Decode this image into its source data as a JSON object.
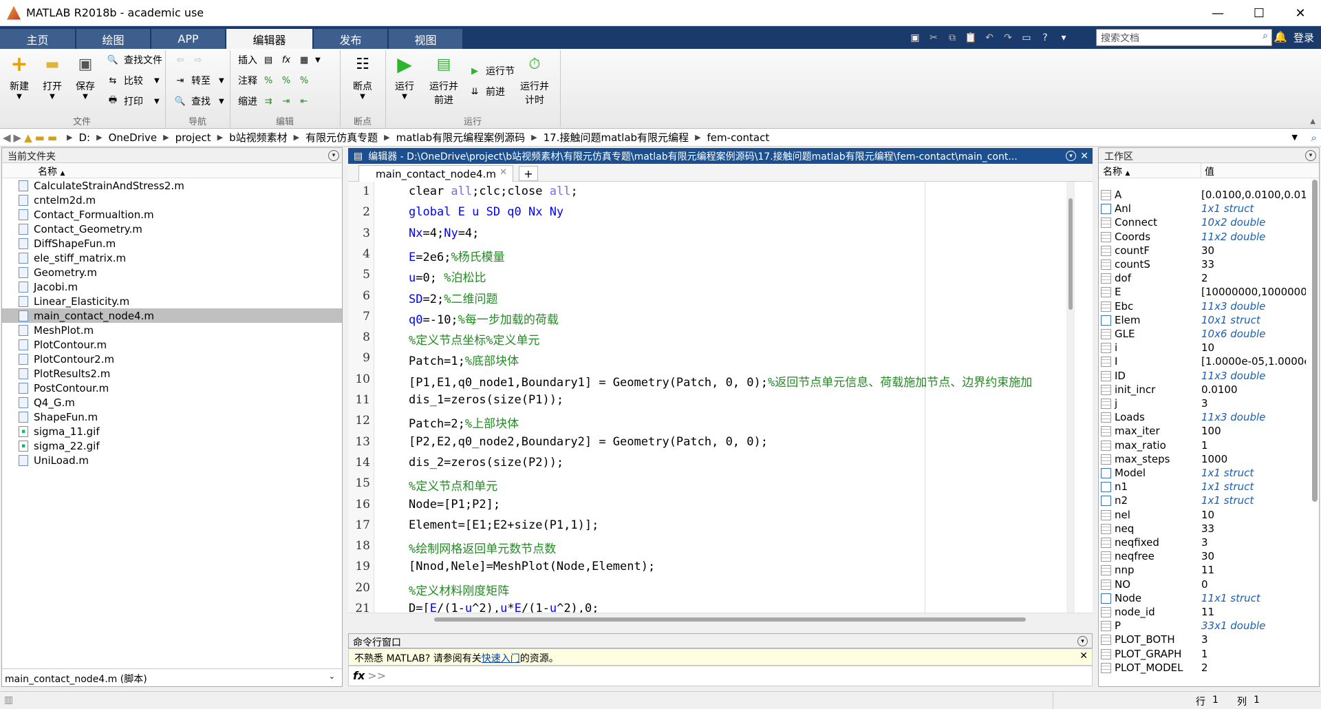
{
  "window": {
    "title": "MATLAB R2018b - academic use"
  },
  "ribbon_tabs": [
    "主页",
    "绘图",
    "APP",
    "编辑器",
    "发布",
    "视图"
  ],
  "search": {
    "placeholder": "搜索文档"
  },
  "login": "登录",
  "ribbon": {
    "file": {
      "new": "新建",
      "open": "打开",
      "save": "保存",
      "find_files": "查找文件",
      "compare": "比较",
      "print": "打印",
      "group": "文件"
    },
    "nav": {
      "goto": "转至",
      "find": "查找",
      "group": "导航"
    },
    "edit": {
      "insert": "插入",
      "comment": "注释",
      "indent": "缩进",
      "group": "编辑"
    },
    "bp": {
      "breakpoints": "断点",
      "group": "断点"
    },
    "run": {
      "run": "运行",
      "run_advance_1": "运行并",
      "run_advance_2": "前进",
      "run_section": "运行节",
      "advance": "前进",
      "run_time_1": "运行并",
      "run_time_2": "计时",
      "group": "运行"
    }
  },
  "address": [
    "D:",
    "OneDrive",
    "project",
    "b站视频素材",
    "有限元仿真专题",
    "matlab有限元编程案例源码",
    "17.接触问题matlab有限元编程",
    "fem-contact"
  ],
  "current_folder": {
    "title": "当前文件夹",
    "column": "名称",
    "files": [
      {
        "name": "CalculateStrainAndStress2.m",
        "type": "m"
      },
      {
        "name": "cntelm2d.m",
        "type": "m"
      },
      {
        "name": "Contact_Formualtion.m",
        "type": "m"
      },
      {
        "name": "Contact_Geometry.m",
        "type": "m"
      },
      {
        "name": "DiffShapeFun.m",
        "type": "m"
      },
      {
        "name": "ele_stiff_matrix.m",
        "type": "m"
      },
      {
        "name": "Geometry.m",
        "type": "m"
      },
      {
        "name": "Jacobi.m",
        "type": "m"
      },
      {
        "name": "Linear_Elasticity.m",
        "type": "m"
      },
      {
        "name": "main_contact_node4.m",
        "type": "m",
        "selected": true
      },
      {
        "name": "MeshPlot.m",
        "type": "m"
      },
      {
        "name": "PlotContour.m",
        "type": "m"
      },
      {
        "name": "PlotContour2.m",
        "type": "m"
      },
      {
        "name": "PlotResults2.m",
        "type": "m"
      },
      {
        "name": "PostContour.m",
        "type": "m"
      },
      {
        "name": "Q4_G.m",
        "type": "m"
      },
      {
        "name": "ShapeFun.m",
        "type": "m"
      },
      {
        "name": "sigma_11.gif",
        "type": "gif"
      },
      {
        "name": "sigma_22.gif",
        "type": "gif"
      },
      {
        "name": "UniLoad.m",
        "type": "m"
      }
    ],
    "details": "main_contact_node4.m  (脚本)"
  },
  "editor": {
    "title": "编辑器 - D:\\OneDrive\\project\\b站视频素材\\有限元仿真专题\\matlab有限元编程案例源码\\17.接触问题matlab有限元编程\\fem-contact\\main_cont...",
    "tab": "main_contact_node4.m",
    "lines": [
      [
        [
          "clear ",
          ""
        ],
        [
          "all",
          "rd"
        ],
        [
          ";clc;close ",
          ""
        ],
        [
          "all",
          "rd"
        ],
        [
          ";",
          ""
        ]
      ],
      [
        [
          "global E u SD q0 Nx Ny",
          "kw"
        ]
      ],
      [
        [
          "Nx",
          "kw"
        ],
        [
          "=4;",
          ""
        ],
        [
          "Ny",
          "kw"
        ],
        [
          "=4;",
          ""
        ]
      ],
      [
        [
          "E",
          "kw"
        ],
        [
          "=2e6;",
          ""
        ],
        [
          "%杨氏模量",
          "cm"
        ]
      ],
      [
        [
          "u",
          "kw"
        ],
        [
          "=0; ",
          ""
        ],
        [
          "%泊松比",
          "cm"
        ]
      ],
      [
        [
          "SD",
          "kw"
        ],
        [
          "=2;",
          ""
        ],
        [
          "%二维问题",
          "cm"
        ]
      ],
      [
        [
          "q0",
          "kw"
        ],
        [
          "=-10;",
          ""
        ],
        [
          "%每一步加载的荷载",
          "cm"
        ]
      ],
      [
        [
          "%定义节点坐标%定义单元",
          "cm"
        ]
      ],
      [
        [
          "Patch=1;",
          ""
        ],
        [
          "%底部块体",
          "cm"
        ]
      ],
      [
        [
          "[P1,E1,q0_node1,Boundary1] = Geometry(Patch, 0, 0);",
          ""
        ],
        [
          "%返回节点单元信息、荷载施加节点、边界约束施加",
          "cm"
        ]
      ],
      [
        [
          "dis_1=zeros(size(P1));",
          ""
        ]
      ],
      [
        [
          "Patch=2;",
          ""
        ],
        [
          "%上部块体",
          "cm"
        ]
      ],
      [
        [
          "[P2,E2,q0_node2,Boundary2] = Geometry(Patch, 0, 0);",
          ""
        ]
      ],
      [
        [
          "dis_2=zeros(size(P2));",
          ""
        ]
      ],
      [
        [
          "%定义节点和单元",
          "cm"
        ]
      ],
      [
        [
          "Node=[P1;P2];",
          ""
        ]
      ],
      [
        [
          "Element=[E1;E2+size(P1,1)];",
          ""
        ]
      ],
      [
        [
          "%绘制网格返回单元数节点数",
          "cm"
        ]
      ],
      [
        [
          "[Nnod,Nele]=MeshPlot(Node,Element);",
          ""
        ]
      ],
      [
        [
          "%定义材料刚度矩阵",
          "cm"
        ]
      ],
      [
        [
          "D=[",
          ""
        ],
        [
          "E",
          "kw"
        ],
        [
          "/(1-",
          ""
        ],
        [
          "u",
          "kw"
        ],
        [
          "^2),",
          ""
        ],
        [
          "u",
          "kw"
        ],
        [
          "*",
          ""
        ],
        [
          "E",
          "kw"
        ],
        [
          "/(1-",
          ""
        ],
        [
          "u",
          "kw"
        ],
        [
          "^2),0;",
          ""
        ]
      ]
    ]
  },
  "command_window": {
    "title": "命令行窗口",
    "hint_pre": "不熟悉 MATLAB? 请参阅有关",
    "hint_link": "快速入门",
    "hint_post": "的资源。",
    "prompt": ">>"
  },
  "workspace": {
    "title": "工作区",
    "col_name": "名称",
    "col_value": "值",
    "vars": [
      {
        "name": "A",
        "value": "[0.0100,0.0100,0.010",
        "t": "d"
      },
      {
        "name": "Anl",
        "value": "1x1 struct",
        "t": "s"
      },
      {
        "name": "Connect",
        "value": "10x2 double",
        "t": "m"
      },
      {
        "name": "Coords",
        "value": "11x2 double",
        "t": "m"
      },
      {
        "name": "countF",
        "value": "30",
        "t": "d"
      },
      {
        "name": "countS",
        "value": "33",
        "t": "d"
      },
      {
        "name": "dof",
        "value": "2",
        "t": "d"
      },
      {
        "name": "E",
        "value": "[10000000,10000000",
        "t": "d"
      },
      {
        "name": "Ebc",
        "value": "11x3 double",
        "t": "m"
      },
      {
        "name": "Elem",
        "value": "10x1 struct",
        "t": "s"
      },
      {
        "name": "GLE",
        "value": "10x6 double",
        "t": "m"
      },
      {
        "name": "i",
        "value": "10",
        "t": "d"
      },
      {
        "name": "I",
        "value": "[1.0000e-05,1.0000e",
        "t": "d"
      },
      {
        "name": "ID",
        "value": "11x3 double",
        "t": "m"
      },
      {
        "name": "init_incr",
        "value": "0.0100",
        "t": "d"
      },
      {
        "name": "j",
        "value": "3",
        "t": "d"
      },
      {
        "name": "Loads",
        "value": "11x3 double",
        "t": "m"
      },
      {
        "name": "max_iter",
        "value": "100",
        "t": "d"
      },
      {
        "name": "max_ratio",
        "value": "1",
        "t": "d"
      },
      {
        "name": "max_steps",
        "value": "1000",
        "t": "d"
      },
      {
        "name": "Model",
        "value": "1x1 struct",
        "t": "s"
      },
      {
        "name": "n1",
        "value": "1x1 struct",
        "t": "s"
      },
      {
        "name": "n2",
        "value": "1x1 struct",
        "t": "s"
      },
      {
        "name": "nel",
        "value": "10",
        "t": "d"
      },
      {
        "name": "neq",
        "value": "33",
        "t": "d"
      },
      {
        "name": "neqfixed",
        "value": "3",
        "t": "d"
      },
      {
        "name": "neqfree",
        "value": "30",
        "t": "d"
      },
      {
        "name": "nnp",
        "value": "11",
        "t": "d"
      },
      {
        "name": "NO",
        "value": "0",
        "t": "d"
      },
      {
        "name": "Node",
        "value": "11x1 struct",
        "t": "s"
      },
      {
        "name": "node_id",
        "value": "11",
        "t": "d"
      },
      {
        "name": "P",
        "value": "33x1 double",
        "t": "m"
      },
      {
        "name": "PLOT_BOTH",
        "value": "3",
        "t": "d"
      },
      {
        "name": "PLOT_GRAPH",
        "value": "1",
        "t": "d"
      },
      {
        "name": "PLOT_MODEL",
        "value": "2",
        "t": "d"
      }
    ]
  },
  "status": {
    "row_label": "行",
    "row": "1",
    "col_label": "列",
    "col": "1"
  }
}
